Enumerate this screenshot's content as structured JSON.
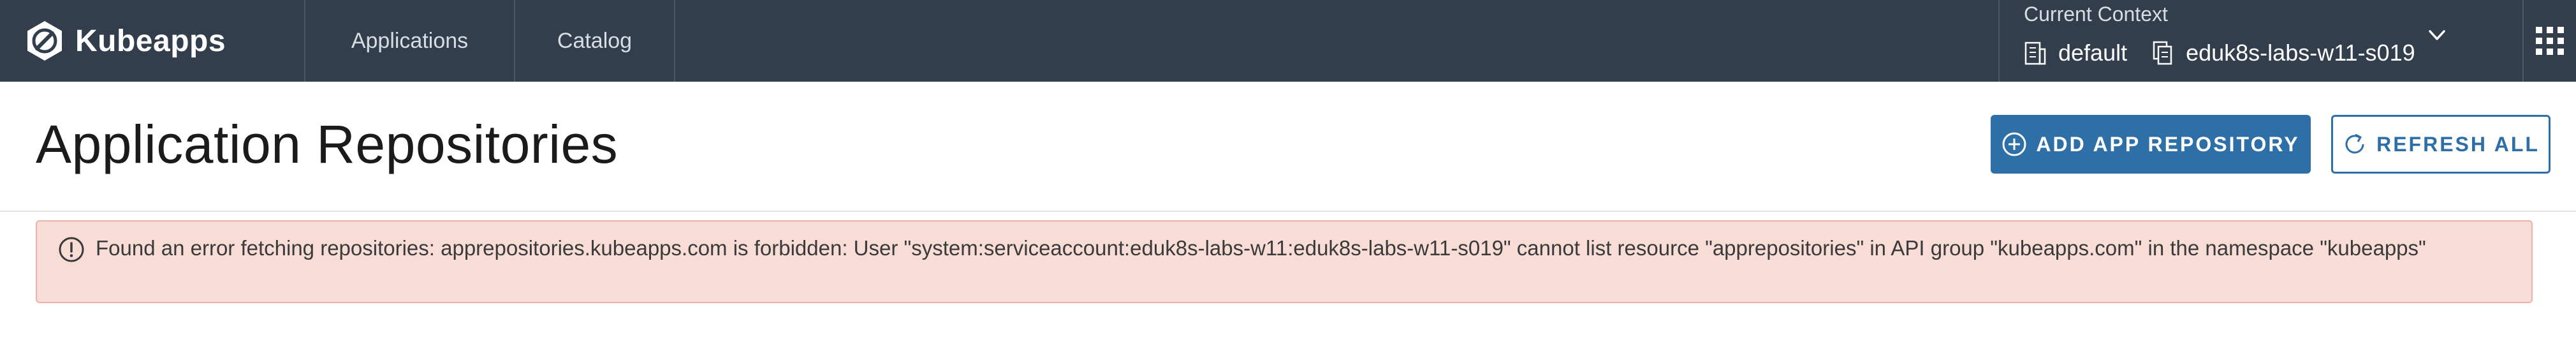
{
  "header": {
    "brand_name": "Kubeapps",
    "nav": [
      {
        "label": "Applications"
      },
      {
        "label": "Catalog"
      }
    ],
    "context": {
      "title": "Current Context",
      "cluster": "default",
      "namespace": "eduk8s-labs-w11-s019"
    },
    "icons": {
      "logo": "kubeapps-logo-icon",
      "cluster": "building-icon",
      "namespace": "copy-icon",
      "dropdown": "chevron-down-icon",
      "apps_menu": "grid-icon"
    }
  },
  "page": {
    "title": "Application Repositories",
    "add_button": "ADD APP REPOSITORY",
    "refresh_button": "REFRESH ALL"
  },
  "alert": {
    "message": "Found an error fetching repositories: apprepositories.kubeapps.com is forbidden: User \"system:serviceaccount:eduk8s-labs-w11:eduk8s-labs-w11-s019\" cannot list resource \"apprepositories\" in API group \"kubeapps.com\" in the namespace \"kubeapps\"",
    "icon": "exclamation-circle-icon"
  },
  "colors": {
    "header_bg": "#323e4c",
    "primary": "#2d6fa6",
    "alert_bg": "#f8dcd6",
    "alert_border": "#ebb4ab"
  }
}
